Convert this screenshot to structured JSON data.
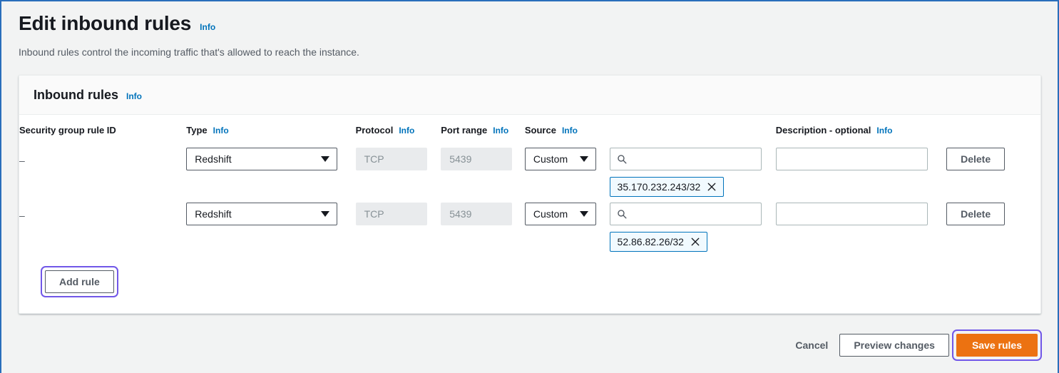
{
  "page": {
    "title": "Edit inbound rules",
    "title_info": "Info",
    "description": "Inbound rules control the incoming traffic that's allowed to reach the instance."
  },
  "card": {
    "header_title": "Inbound rules",
    "header_info": "Info"
  },
  "table": {
    "columns": [
      {
        "label": "Security group rule ID",
        "info": ""
      },
      {
        "label": "Type",
        "info": "Info"
      },
      {
        "label": "Protocol",
        "info": "Info"
      },
      {
        "label": "Port range",
        "info": "Info"
      },
      {
        "label": "Source",
        "info": "Info"
      },
      {
        "label": "",
        "info": ""
      },
      {
        "label": "Description - optional",
        "info": "Info"
      },
      {
        "label": "",
        "info": ""
      }
    ],
    "rows": [
      {
        "rule_id": "–",
        "type": "Redshift",
        "protocol": "TCP",
        "port_range": "5439",
        "source": "Custom",
        "source_search_value": "",
        "cidr_token": "35.170.232.243/32",
        "description": "",
        "delete_label": "Delete"
      },
      {
        "rule_id": "–",
        "type": "Redshift",
        "protocol": "TCP",
        "port_range": "5439",
        "source": "Custom",
        "source_search_value": "",
        "cidr_token": "52.86.82.26/32",
        "description": "",
        "delete_label": "Delete"
      }
    ],
    "add_rule_label": "Add rule"
  },
  "footer": {
    "cancel_label": "Cancel",
    "preview_label": "Preview changes",
    "save_label": "Save rules"
  },
  "icons": {
    "search": "search-icon",
    "close": "close-icon",
    "chevron_down": "chevron-down-icon"
  },
  "colors": {
    "accent_link": "#0073bb",
    "primary_button": "#ec7211",
    "focus_ring": "#7157e8",
    "page_border": "#2a6ebb",
    "token_border": "#0073bb"
  }
}
